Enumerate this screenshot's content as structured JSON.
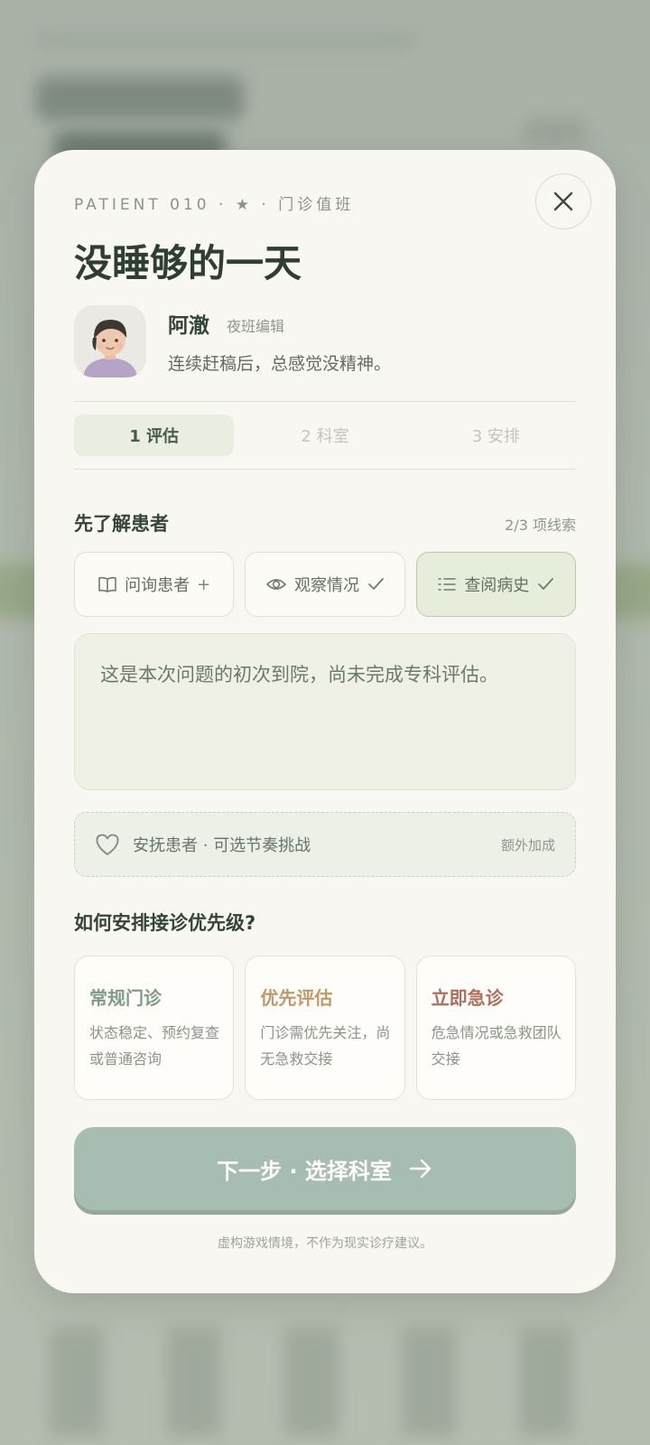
{
  "modal": {
    "eyebrow": "PATIENT 010 · ★ · 门诊值班",
    "title": "没睡够的一天",
    "close_icon": "close-icon"
  },
  "patient": {
    "name": "阿澈",
    "role": "夜班编辑",
    "description": "连续赶稿后，总感觉没精神。",
    "avatar_icon": "patient-avatar"
  },
  "steps": [
    {
      "label": "1 评估",
      "active": true
    },
    {
      "label": "2 科室",
      "active": false
    },
    {
      "label": "3 安排",
      "active": false
    }
  ],
  "clues_section": {
    "title": "先了解患者",
    "count": "2/3 项线索",
    "items": [
      {
        "label": "问询患者",
        "icon": "book-icon",
        "suffix": "+",
        "done": false
      },
      {
        "label": "观察情况",
        "icon": "eye-icon",
        "suffix": "check",
        "done": true
      },
      {
        "label": "查阅病史",
        "icon": "list-icon",
        "suffix": "check",
        "done": true
      }
    ]
  },
  "info_text": "这是本次问题的初次到院，尚未完成专科评估。",
  "bonus": {
    "icon": "heart-icon",
    "label": "安抚患者 · 可选节奏挑战",
    "tag": "额外加成"
  },
  "priority_section": {
    "title": "如何安排接诊优先级?",
    "options": [
      {
        "title": "常规门诊",
        "desc": "状态稳定、预约复查或普通咨询",
        "color": "#7e9a8a"
      },
      {
        "title": "优先评估",
        "desc": "门诊需优先关注，尚无急救交接",
        "color": "#c0986a"
      },
      {
        "title": "立即急诊",
        "desc": "危急情况或急救团队交接",
        "color": "#b06d5d"
      }
    ]
  },
  "next_button": {
    "label": "下一步 · 选择科室",
    "icon": "arrow-right-icon"
  },
  "footnote": "虚构游戏情境，不作为现实诊疗建议。",
  "colors": {
    "card_bg": "#f8f7f1",
    "accent_green": "#a8bdb1",
    "title_text": "#2f3e35"
  }
}
